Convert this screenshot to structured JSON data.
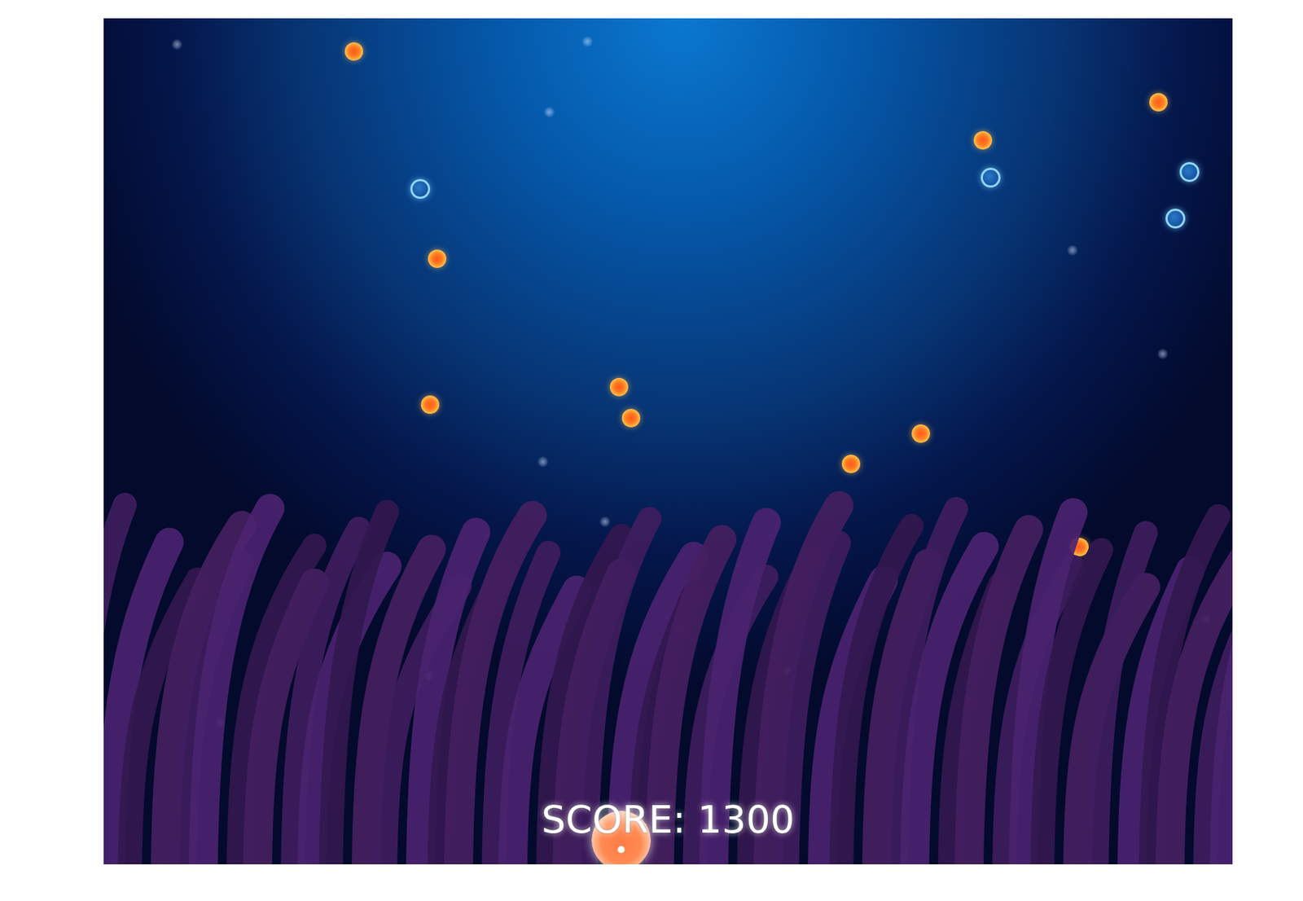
{
  "hud": {
    "score": "SCORE: 1300"
  },
  "orbs": [
    {
      "kind": "food"
    },
    {
      "kind": "food"
    },
    {
      "kind": "food"
    },
    {
      "kind": "food"
    },
    {
      "kind": "food"
    },
    {
      "kind": "food"
    },
    {
      "kind": "food"
    },
    {
      "kind": "food"
    },
    {
      "kind": "food"
    },
    {
      "kind": "food"
    },
    {
      "kind": "bubble"
    },
    {
      "kind": "bubble"
    },
    {
      "kind": "bubble"
    },
    {
      "kind": "bubble"
    }
  ]
}
